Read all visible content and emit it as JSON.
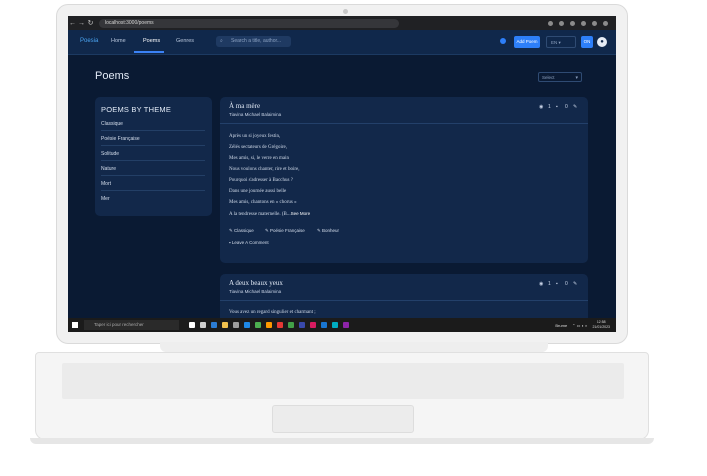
{
  "browser": {
    "url": "localhost:3000/poems"
  },
  "app": {
    "brand": "Poesia",
    "nav": [
      "Home",
      "Poems",
      "Genres"
    ],
    "active_nav": "Poems",
    "search_placeholder": "Search a title, author...",
    "add_poem_label": "Add Poem",
    "lang_label": "EN",
    "user_badge": "ON"
  },
  "page": {
    "title": "Poems",
    "sort_placeholder": "Select"
  },
  "themes": {
    "title": "POEMS BY THEME",
    "items": [
      "Classique",
      "Poésie Française",
      "Solitude",
      "Nature",
      "Mort",
      "Mer"
    ]
  },
  "poems": [
    {
      "title": "À ma mère",
      "author": "Tiavina Michael Balaimina",
      "views": "1",
      "comments": "0",
      "lines": [
        "Après un si joyeux festin,",
        "Zélés sectateurs de Grégoire,",
        "Mes amis, si, le verre en main",
        "Nous voulons chanter, rire et boire,",
        "Pourquoi s'adresser à Bacchus ?",
        "Dans une journée aussi belle",
        "Mes amis, chantons en « chorus »",
        "A la tendresse maternelle. (B..."
      ],
      "see_more": "See More",
      "tags": [
        "Classique",
        "Poésie Française",
        "Bonheur"
      ],
      "comment_label": "Leave A Comment"
    },
    {
      "title": "A deux beaux yeux",
      "author": "Tiavina Michael Balaimina",
      "views": "1",
      "comments": "0",
      "lines": [
        "Vous avez un regard singulier et charmant ;"
      ]
    }
  ],
  "taskbar": {
    "search_placeholder": "Taper ici pour rechercher",
    "weather": "Brume",
    "time": "12:58",
    "date": "21/01/2023"
  }
}
